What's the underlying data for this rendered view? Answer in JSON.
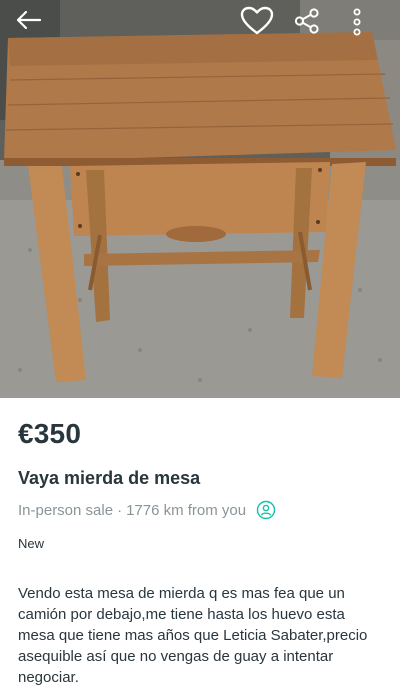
{
  "listing": {
    "price": "€350",
    "title": "Vaya mierda de mesa",
    "delivery": "In-person sale",
    "separator": "·",
    "distance": "1776 km from you",
    "condition": "New",
    "description": "Vendo esta mesa de mierda q es mas fea que un camión por debajo,me tiene hasta los huevo esta mesa que tiene mas años que  Leticia Sabater,precio asequible así que no vengas de guay a intentar negociar."
  },
  "colors": {
    "text": "#29363d",
    "muted": "#8a9499",
    "accent": "#13c1ac",
    "wood": "#b47c46"
  },
  "icons": {
    "back": "arrow-left-icon",
    "favorite": "heart-icon",
    "share": "share-icon",
    "more": "more-vertical-icon",
    "shipping": "person-pin-icon"
  }
}
